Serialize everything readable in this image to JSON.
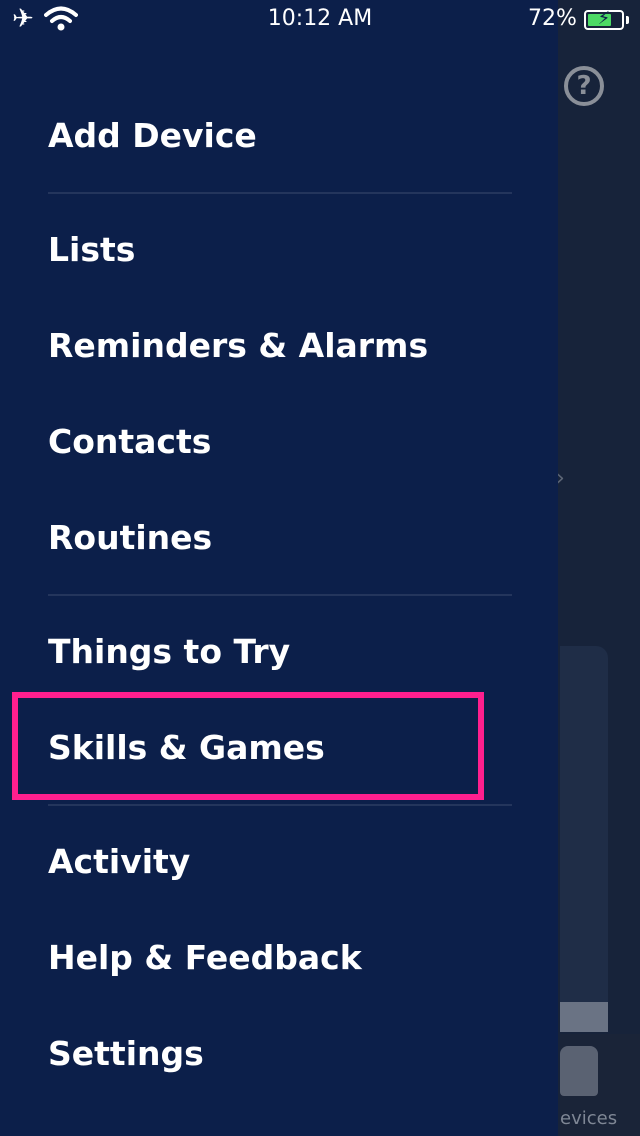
{
  "status_bar": {
    "time": "10:12 AM",
    "battery_percent": "72%",
    "battery_level": 0.72,
    "icons": [
      "airplane-icon",
      "wifi-icon",
      "battery-charging-icon"
    ]
  },
  "drawer": {
    "items": [
      {
        "label": "Add Device"
      },
      {
        "label": "Lists"
      },
      {
        "label": "Reminders & Alarms"
      },
      {
        "label": "Contacts"
      },
      {
        "label": "Routines"
      },
      {
        "label": "Things to Try"
      },
      {
        "label": "Skills & Games"
      },
      {
        "label": "Activity"
      },
      {
        "label": "Help & Feedback"
      },
      {
        "label": "Settings"
      }
    ],
    "highlighted_item": "Skills & Games",
    "highlight_color": "#ff1f8e"
  },
  "background": {
    "help_icon": "?",
    "devices_tab_label": "evices"
  },
  "colors": {
    "drawer_bg": "#0c1f4a",
    "text": "#ffffff",
    "divider": "#24355c"
  }
}
